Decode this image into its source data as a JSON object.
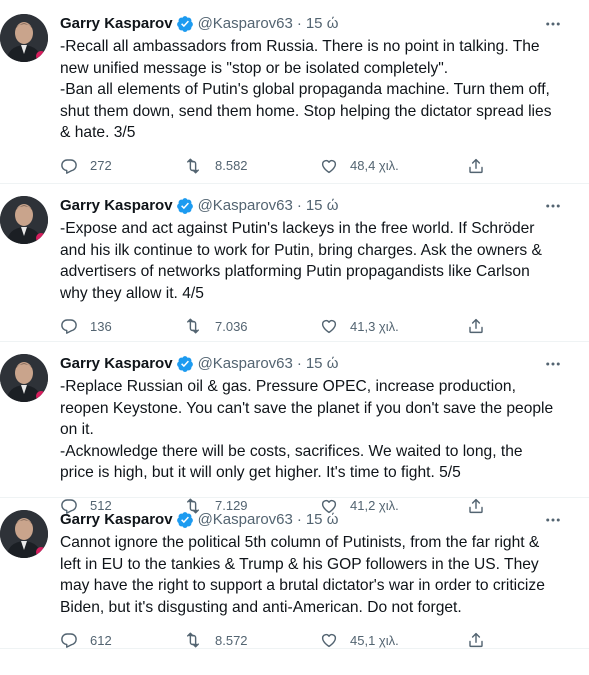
{
  "tweets": [
    {
      "author": "Garry Kasparov",
      "handle": "@Kasparov63",
      "separator": "·",
      "time": "15 ώ",
      "text": "-Recall all ambassadors from Russia. There is no point in talking. The new unified message is \"stop or be isolated completely\".\n-Ban all elements of Putin's global propaganda machine. Turn them off, shut them down, send them home. Stop helping the dictator spread lies & hate. 3/5",
      "replies": "272",
      "retweets": "8.582",
      "likes": "48,4 χιλ."
    },
    {
      "author": "Garry Kasparov",
      "handle": "@Kasparov63",
      "separator": "·",
      "time": "15 ώ",
      "text": "-Expose and act against Putin's lackeys in the free world. If Schröder and his ilk continue to work for Putin, bring charges. Ask the owners & advertisers of networks platforming Putin propagandists like Carlson why they allow it. 4/5",
      "replies": "136",
      "retweets": "7.036",
      "likes": "41,3 χιλ."
    },
    {
      "author": "Garry Kasparov",
      "handle": "@Kasparov63",
      "separator": "·",
      "time": "15 ώ",
      "text": "-Replace Russian oil & gas. Pressure OPEC, increase production, reopen Keystone. You can't save the planet if you don't save the people on it.\n-Acknowledge there will be costs, sacrifices. We waited to long, the price is high, but it will only get higher. It's time to fight. 5/5",
      "replies": "512",
      "retweets": "7.129",
      "likes": "41,2 χιλ."
    },
    {
      "author": "Garry Kasparov",
      "handle": "@Kasparov63",
      "separator": "·",
      "time": "15 ώ",
      "text": "Cannot ignore the political 5th column of Putinists, from the far right & left in EU to the tankies & Trump & his GOP followers in the US. They may have the right to support a brutal dictator's war in order to criticize Biden, but it's disgusting and anti-American. Do not forget.",
      "replies": "612",
      "retweets": "8.572",
      "likes": "45,1 χιλ."
    }
  ],
  "icons": {
    "verified": "verified-badge-icon",
    "more": "more-options-icon",
    "reply": "reply-icon",
    "retweet": "retweet-icon",
    "like": "like-icon",
    "share": "share-icon"
  },
  "colors": {
    "verified": "#1d9bf0",
    "text": "#0f1419",
    "secondary": "#536471",
    "divider": "#eff3f4"
  }
}
